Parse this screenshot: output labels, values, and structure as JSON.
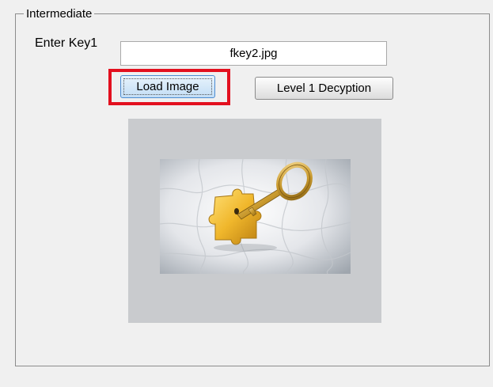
{
  "group": {
    "title": "Intermediate"
  },
  "key_input": {
    "label": "Enter Key1",
    "value": "fkey2.jpg"
  },
  "buttons": {
    "load_image": "Load Image",
    "level1_decryption": "Level 1 Decyption"
  },
  "colors": {
    "background": "#f0f0f0",
    "highlight": "#e3101f",
    "image_panel": "#c9cbce",
    "key_gold": "#c99a2e"
  },
  "image": {
    "icon": "key-in-puzzle-icon"
  }
}
